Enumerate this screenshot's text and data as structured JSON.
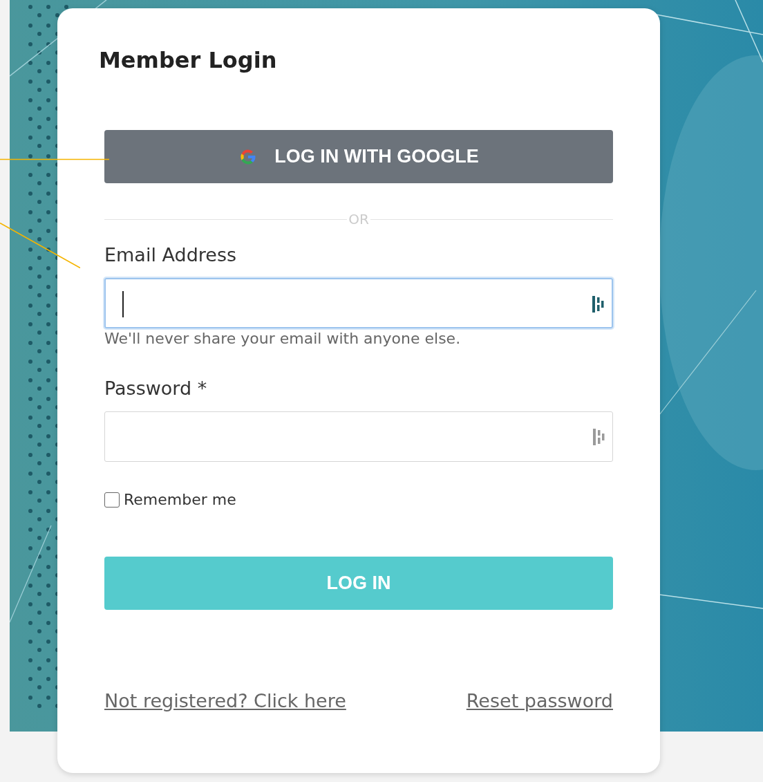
{
  "title": "Member Login",
  "google_button": {
    "label": "LOG IN WITH GOOGLE"
  },
  "divider": {
    "label": "OR"
  },
  "fields": [
    {
      "label": "Email Address",
      "focused": true,
      "help": "We'll never share your email with anyone else."
    },
    {
      "label": "Password *",
      "focused": false
    }
  ],
  "remember": {
    "label": "Remember me",
    "checked": false
  },
  "login_button": {
    "label": "LOG IN"
  },
  "links": [
    "Not registered? Click here",
    "Reset password"
  ]
}
